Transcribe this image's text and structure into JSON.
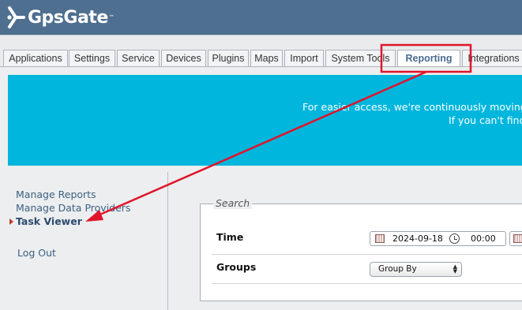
{
  "header": {
    "logo_text": "GpsGate",
    "logo_tm": "™",
    "background": "#4f6f90"
  },
  "tabs": [
    {
      "label": "Applications",
      "active": false
    },
    {
      "label": "Settings",
      "active": false
    },
    {
      "label": "Service",
      "active": false
    },
    {
      "label": "Devices",
      "active": false
    },
    {
      "label": "Plugins",
      "active": false
    },
    {
      "label": "Maps",
      "active": false
    },
    {
      "label": "Import",
      "active": false
    },
    {
      "label": "System Tools",
      "active": false
    },
    {
      "label": "Reporting",
      "active": true
    },
    {
      "label": "Integrations",
      "active": false
    }
  ],
  "banner": {
    "line1": "For easier access, we're continuously moving",
    "line2": "If you can't find",
    "color": "#00b6dd"
  },
  "sidebar": {
    "items": [
      {
        "label": "Manage Reports",
        "active": false
      },
      {
        "label": "Manage Data Providers",
        "active": false
      },
      {
        "label": "Task Viewer",
        "active": true
      },
      {
        "label": "Log Out",
        "active": false
      }
    ]
  },
  "search": {
    "legend": "Search",
    "time_label": "Time",
    "date_value": "2024-09-18",
    "time_value": "00:00",
    "groups_label": "Groups",
    "groups_selected": "Group By"
  },
  "annotation": {
    "color": "#e0142a",
    "from": "Reporting",
    "to": "Task Viewer"
  },
  "icons": [
    "gpsgate-logo-icon",
    "calendar-icon",
    "clock-icon",
    "select-arrows-icon",
    "active-item-marker-icon"
  ]
}
